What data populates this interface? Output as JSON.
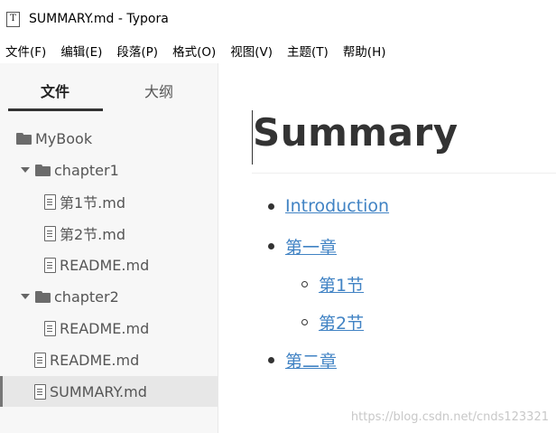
{
  "window": {
    "title": "SUMMARY.md - Typora",
    "app_icon": "T"
  },
  "menu": [
    "文件(F)",
    "编辑(E)",
    "段落(P)",
    "格式(O)",
    "视图(V)",
    "主题(T)",
    "帮助(H)"
  ],
  "sidebar": {
    "tabs": {
      "files": "文件",
      "outline": "大纲"
    },
    "tree": [
      {
        "label": "MyBook",
        "icon": "folder-icon"
      },
      {
        "label": "chapter1",
        "icon": "folder-icon",
        "expanded": true
      },
      {
        "label": "第1节.md",
        "icon": "file-icon"
      },
      {
        "label": "第2节.md",
        "icon": "file-icon"
      },
      {
        "label": "README.md",
        "icon": "file-icon"
      },
      {
        "label": "chapter2",
        "icon": "folder-icon",
        "expanded": true
      },
      {
        "label": "README.md",
        "icon": "file-icon"
      },
      {
        "label": "README.md",
        "icon": "file-icon"
      },
      {
        "label": "SUMMARY.md",
        "icon": "file-icon",
        "active": true
      }
    ]
  },
  "editor": {
    "title": "Summary",
    "links": [
      "Introduction",
      "第一章",
      "第1节",
      "第2节",
      "第二章"
    ]
  },
  "watermark": "https://blog.csdn.net/cnds123321",
  "colors": {
    "link": "#4183c4",
    "sidebar_bg": "#f7f7f7",
    "active_row": "#e7e7e7"
  }
}
